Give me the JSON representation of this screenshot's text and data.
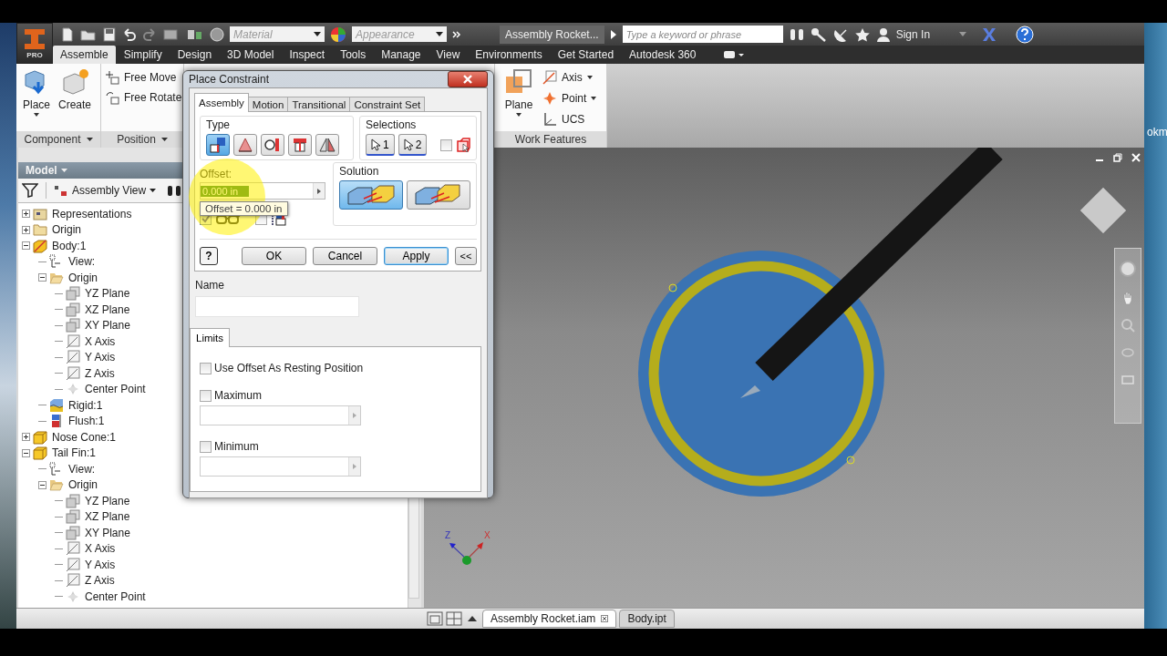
{
  "app": {
    "badge": "PRO",
    "material": "Material",
    "appearance": "Appearance",
    "title": "Assembly Rocket...",
    "search_placeholder": "Type a keyword or phrase",
    "sign_in": "Sign In"
  },
  "ribbon_tabs": [
    {
      "label": "Assemble",
      "selected": true
    },
    {
      "label": "Simplify",
      "selected": false
    },
    {
      "label": "Design",
      "selected": false
    },
    {
      "label": "3D Model",
      "selected": false
    },
    {
      "label": "Inspect",
      "selected": false
    },
    {
      "label": "Tools",
      "selected": false
    },
    {
      "label": "Manage",
      "selected": false
    },
    {
      "label": "View",
      "selected": false
    },
    {
      "label": "Environments",
      "selected": false
    },
    {
      "label": "Get Started",
      "selected": false
    },
    {
      "label": "Autodesk 360",
      "selected": false
    }
  ],
  "ribbon_panels": [
    {
      "title": "Component",
      "tools": [
        {
          "label": "Place",
          "kind": "place"
        },
        {
          "label": "Create",
          "kind": "create"
        }
      ]
    },
    {
      "title": "Position",
      "tools": [
        {
          "label": "Free Move",
          "kind": "move"
        },
        {
          "label": "Free Rotate",
          "kind": "rotate"
        }
      ]
    },
    {
      "title": "Work Features",
      "tools": [
        {
          "label": "Plane",
          "kind": "plane"
        },
        {
          "label": "Axis",
          "kind": "axis"
        },
        {
          "label": "Point",
          "kind": "point"
        },
        {
          "label": "UCS",
          "kind": "ucs"
        }
      ]
    }
  ],
  "browser": {
    "title": "Model",
    "view": "Assembly View",
    "tree": [
      {
        "label": "Representations",
        "kind": "representations",
        "expanded": false
      },
      {
        "label": "Origin",
        "kind": "folder",
        "expanded": false
      },
      {
        "label": "Body:1",
        "kind": "part-edit",
        "expanded": true,
        "children": [
          {
            "label": "View:",
            "kind": "view"
          },
          {
            "label": "Origin",
            "kind": "open-folder",
            "expanded": true,
            "children": [
              {
                "label": "YZ Plane",
                "kind": "plane"
              },
              {
                "label": "XZ Plane",
                "kind": "plane"
              },
              {
                "label": "XY Plane",
                "kind": "plane"
              },
              {
                "label": "X Axis",
                "kind": "axis"
              },
              {
                "label": "Y Axis",
                "kind": "axis"
              },
              {
                "label": "Z Axis",
                "kind": "axis"
              },
              {
                "label": "Center Point",
                "kind": "point"
              }
            ]
          },
          {
            "label": "Rigid:1",
            "kind": "rigid"
          },
          {
            "label": "Flush:1",
            "kind": "flush"
          }
        ]
      },
      {
        "label": "Nose Cone:1",
        "kind": "part",
        "expanded": false
      },
      {
        "label": "Tail Fin:1",
        "kind": "part",
        "expanded": true,
        "children": [
          {
            "label": "View:",
            "kind": "view"
          },
          {
            "label": "Origin",
            "kind": "open-folder",
            "expanded": true,
            "children": [
              {
                "label": "YZ Plane",
                "kind": "plane"
              },
              {
                "label": "XZ Plane",
                "kind": "plane"
              },
              {
                "label": "XY Plane",
                "kind": "plane"
              },
              {
                "label": "X Axis",
                "kind": "axis"
              },
              {
                "label": "Y Axis",
                "kind": "axis"
              },
              {
                "label": "Z Axis",
                "kind": "axis"
              },
              {
                "label": "Center Point",
                "kind": "point"
              }
            ]
          }
        ]
      }
    ]
  },
  "viewport": {
    "triad": {
      "z": "Z",
      "x": "X"
    }
  },
  "doc_tabs": [
    {
      "label": "Assembly Rocket.iam",
      "selected": true
    },
    {
      "label": "Body.ipt",
      "selected": false
    }
  ],
  "behind_window_text": "okm",
  "dialog": {
    "title": "Place Constraint",
    "tabs": [
      {
        "label": "Assembly",
        "selected": true
      },
      {
        "label": "Motion",
        "selected": false
      },
      {
        "label": "Transitional",
        "selected": false
      },
      {
        "label": "Constraint Set",
        "selected": false
      }
    ],
    "type_label": "Type",
    "types": [
      {
        "kind": "mate",
        "selected": true
      },
      {
        "kind": "angle",
        "selected": false
      },
      {
        "kind": "tangent",
        "selected": false
      },
      {
        "kind": "insert",
        "selected": false
      },
      {
        "kind": "symmetry",
        "selected": false
      }
    ],
    "selections_label": "Selections",
    "selections": [
      "1",
      "2"
    ],
    "pick_part_first": false,
    "offset_label": "Offset:",
    "offset_value": "0.000 in",
    "tooltip": "Offset = 0.000 in",
    "show_preview": true,
    "predicted_offset": false,
    "solution_label": "Solution",
    "solutions": [
      {
        "kind": "mate",
        "selected": true
      },
      {
        "kind": "flush",
        "selected": false
      }
    ],
    "help": "?",
    "buttons": [
      {
        "label": "OK",
        "default": false
      },
      {
        "label": "Cancel",
        "default": false
      },
      {
        "label": "Apply",
        "default": true
      }
    ],
    "more": "<<",
    "name_label": "Name",
    "limits_tab": "Limits",
    "limits": [
      {
        "label": "Use Offset As Resting Position",
        "checked": false,
        "kind": "checkbox"
      },
      {
        "label": "Maximum",
        "checked": false,
        "kind": "value"
      },
      {
        "label": "Minimum",
        "checked": false,
        "kind": "value"
      }
    ]
  }
}
